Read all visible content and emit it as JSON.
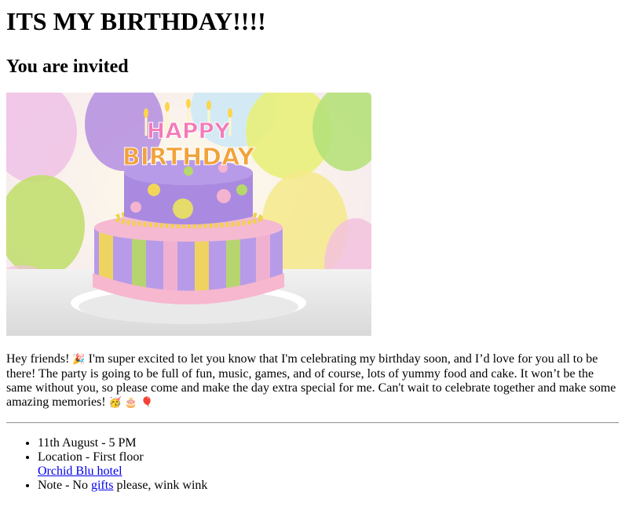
{
  "page": {
    "title": "ITS MY BIRTHDAY!!!!",
    "subtitle": "You are invited"
  },
  "intro": {
    "part1": "Hey friends!",
    "part2": "I'm super excited to let you know that I'm celebrating my birthday soon, and I’d love for you all to be there! The party is going to be full of fun, music, games, and of course, lots of yummy food and cake. It won’t be the same without you, so please come and make the day extra special for me. Can't wait to celebrate together and make some amazing memories!",
    "emoji_party_popper": "🎉",
    "emoji_party_face": "🥳",
    "emoji_cake": "🎂",
    "emoji_balloon": "🎈"
  },
  "details": {
    "date_time": "11th August - 5 PM",
    "location_label": "Location - First floor",
    "location_link": "Orchid Blu hotel",
    "note_prefix": "Note - No ",
    "note_link": "gifts",
    "note_suffix": " please, wink wink"
  },
  "image": {
    "cake_text_top": "HAPPY",
    "cake_text_bottom": "BIRTHDAY"
  },
  "colors": {
    "link": "#0000ee",
    "cake_purple": "#9b7fd6",
    "cake_pink": "#f4b3cf",
    "cake_yellow": "#f2d65a",
    "cake_green": "#b6d86a"
  }
}
